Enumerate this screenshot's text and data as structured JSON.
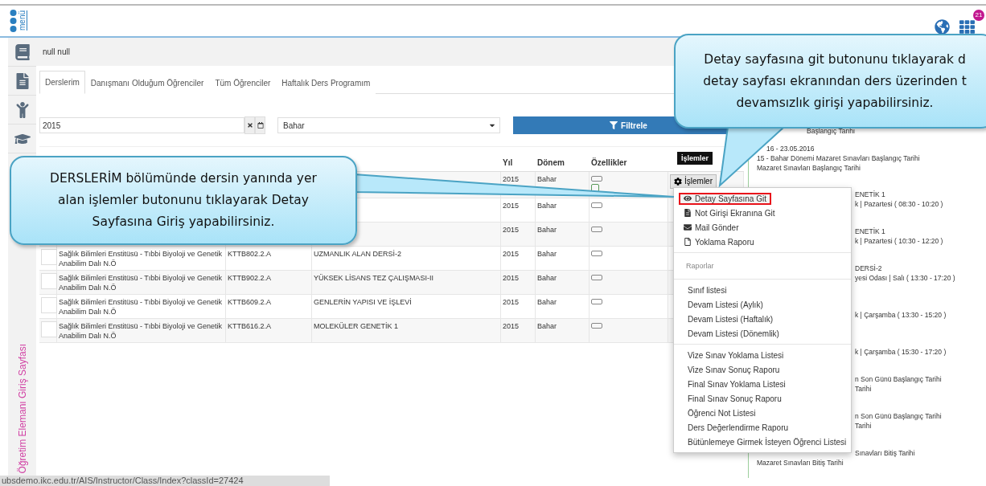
{
  "topbar": {
    "logo_text": "menü",
    "notification_count": "21"
  },
  "header": {
    "user": "null null"
  },
  "tabs": [
    {
      "label": "Derslerim",
      "selected": true
    },
    {
      "label": "Danışmanı Olduğum Öğrenciler",
      "selected": false
    },
    {
      "label": "Tüm Öğrenciler",
      "selected": false
    },
    {
      "label": "Haftalık Ders Programım",
      "selected": false
    }
  ],
  "filters": {
    "year": "2015",
    "term": "Bahar",
    "button": "Filtrele"
  },
  "table": {
    "columns": [
      "Yıl",
      "Dönem",
      "Özellikler"
    ],
    "rows": [
      {
        "year": "2015",
        "term": "Bahar",
        "flagged": true,
        "actions": "İşlemler"
      },
      {
        "year": "2015",
        "term": "Bahar",
        "flagged": false
      },
      {
        "year": "2015",
        "term": "Bahar",
        "flagged": false
      },
      {
        "checked": false,
        "unit": "Sağlık Bilimleri Enstitüsü - Tıbbi Biyoloji ve Genetik Anabilim Dalı N.Ö",
        "code": "KTTB802.2.A",
        "name": "UZMANLIK ALAN DERSİ-2",
        "year": "2015",
        "term": "Bahar",
        "flagged": false
      },
      {
        "checked": false,
        "unit": "Sağlık Bilimleri Enstitüsü - Tıbbi Biyoloji ve Genetik Anabilim Dalı N.Ö",
        "code": "KTTB902.2.A",
        "name": "YÜKSEK LİSANS TEZ ÇALIŞMASI-II",
        "year": "2015",
        "term": "Bahar",
        "flagged": false
      },
      {
        "checked": false,
        "unit": "Sağlık Bilimleri Enstitüsü - Tıbbi Biyoloji ve Genetik Anabilim Dalı N.Ö",
        "code": "KTTB609.2.A",
        "name": "GENLERİN YAPISI VE İŞLEVİ",
        "year": "2015",
        "term": "Bahar",
        "flagged": false
      },
      {
        "checked": false,
        "unit": "Sağlık Bilimleri Enstitüsü - Tıbbi Biyoloji ve Genetik Anabilim Dalı N.Ö",
        "code": "KTTB616.2.A",
        "name": "MOLEKÜLER GENETİK 1",
        "year": "2015",
        "term": "Bahar",
        "flagged": false
      }
    ]
  },
  "tooltip": "İşlemler",
  "menu": [
    {
      "kind": "action",
      "label": "Detay Sayfasına Git",
      "selected": true
    },
    {
      "kind": "action",
      "label": "Not Girişi Ekranına Git",
      "selected": false
    },
    {
      "kind": "action",
      "label": "Mail Gönder",
      "selected": false
    },
    {
      "kind": "action",
      "label": "Yoklama Raporu",
      "selected": false
    },
    {
      "kind": "divider"
    },
    {
      "kind": "header",
      "label": "Raporlar"
    },
    {
      "kind": "divider"
    },
    {
      "kind": "item",
      "label": "Sınıf listesi",
      "selected": false
    },
    {
      "kind": "item",
      "label": "Devam Listesi (Aylık)",
      "selected": false
    },
    {
      "kind": "item",
      "label": "Devam Listesi (Haftalık)",
      "selected": false
    },
    {
      "kind": "item",
      "label": "Devam Listesi (Dönemlik)",
      "selected": false
    },
    {
      "kind": "divider"
    },
    {
      "kind": "item",
      "label": "Vize Sınav Yoklama Listesi",
      "selected": false
    },
    {
      "kind": "item",
      "label": "Vize Sınav Sonuç Raporu",
      "selected": false
    },
    {
      "kind": "item",
      "label": "Final Sınav Yoklama Listesi",
      "selected": false
    },
    {
      "kind": "item",
      "label": "Final Sınav Sonuç Raporu",
      "selected": false
    },
    {
      "kind": "item",
      "label": "Öğrenci Not Listesi",
      "selected": false
    },
    {
      "kind": "item",
      "label": "Ders Değerlendirme Raporu",
      "selected": false
    },
    {
      "kind": "item",
      "label": "Bütünlemeye Girmek İsteyen Öğrenci Listesi",
      "selected": false
    }
  ],
  "timeline": [
    {
      "lines": [
        "Başlangıç Tarihi"
      ]
    },
    {
      "lines": [
        "16 - 23.05.2016",
        "15 - Bahar Dönemi Mazaret Sınavları Başlangıç Tarihi",
        "Mazaret Sınavları Başlangıç Tarihi"
      ]
    },
    {
      "lines": [
        "ENETİK 1",
        "k | Pazartesi ( 08:30 - 10:20 )"
      ]
    },
    {
      "lines": [
        "ENETİK 1",
        "k | Pazartesi ( 10:30 - 12:20 )"
      ]
    },
    {
      "lines": [
        "DERSİ-2",
        "yesi Odası | Salı ( 13:30 - 17:20 )"
      ]
    },
    {
      "lines": [
        "k | Çarşamba ( 13:30 - 15:20 )"
      ]
    },
    {
      "lines": [
        "k | Çarşamba ( 15:30 - 17:20 )"
      ]
    },
    {
      "lines": [
        "n Son Günü Başlangıç Tarihi",
        "Tarihi"
      ]
    },
    {
      "lines": [
        "n Son Günü Başlangıç Tarihi",
        "Tarihi"
      ]
    },
    {
      "lines": [
        "Sınavları Bitiş Tarihi",
        "Mazaret Sınavları Bitiş Tarihi"
      ]
    }
  ],
  "sidebar_caption": "Öğretim Elemanı Giriş Sayfası",
  "status_url": "ubsdemo.ikc.edu.tr/AIS/Instructor/Class/Index?classId=27424",
  "callouts": [
    {
      "lines": [
        "DERSLERİM bölümünde dersin yanında yer",
        "alan işlemler butonunu tıklayarak Detay",
        "Sayfasına Giriş yapabilirsiniz."
      ]
    },
    {
      "lines": [
        "Detay sayfasına git butonunu tıklayarak d",
        "detay sayfası ekranından ders üzerinden t",
        "devamsızlık girişi yapabilirsiniz."
      ]
    }
  ]
}
